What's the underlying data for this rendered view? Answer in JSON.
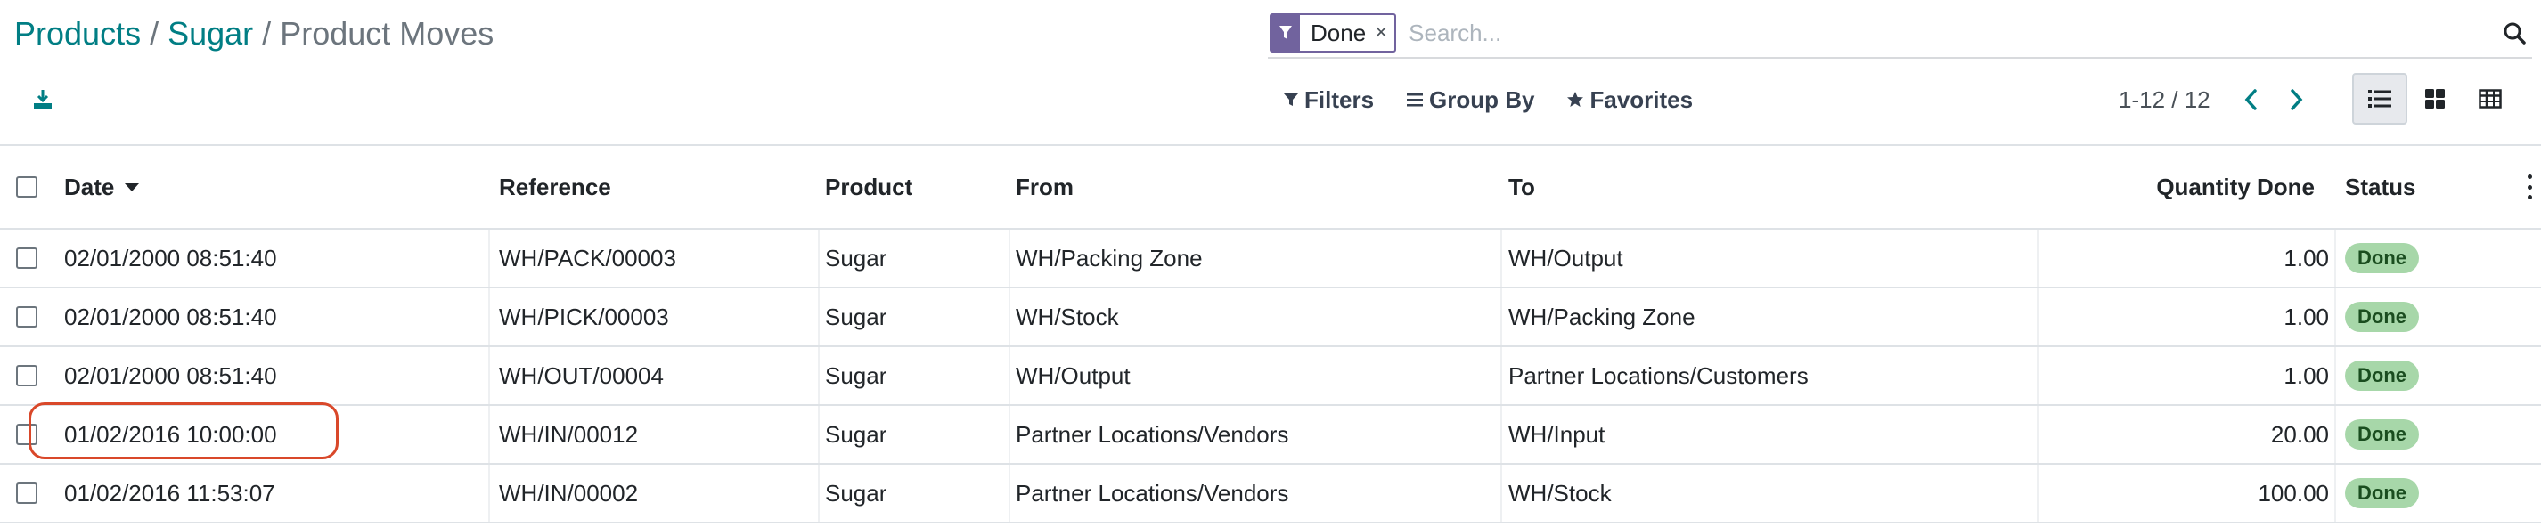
{
  "breadcrumb": {
    "items": [
      {
        "label": "Products"
      },
      {
        "label": "Sugar"
      }
    ],
    "separator": "/",
    "current": "Product Moves"
  },
  "toolbar": {
    "download_icon": "download-icon"
  },
  "search": {
    "facet_icon": "filter-icon",
    "facet_value": "Done",
    "facet_remove": "×",
    "placeholder": "Search...",
    "value": "",
    "search_icon": "search-icon"
  },
  "search_options": {
    "filters": "Filters",
    "group_by": "Group By",
    "favorites": "Favorites"
  },
  "pager": {
    "value": "1-12 / 12"
  },
  "views": [
    {
      "name": "list",
      "icon": "list-view-icon",
      "active": true
    },
    {
      "name": "kanban",
      "icon": "kanban-view-icon",
      "active": false
    },
    {
      "name": "pivot",
      "icon": "pivot-view-icon",
      "active": false
    }
  ],
  "table": {
    "columns": {
      "date": "Date",
      "reference": "Reference",
      "product": "Product",
      "from": "From",
      "to": "To",
      "qty": "Quantity Done",
      "status": "Status"
    },
    "sort_column": "date",
    "sort_direction": "descending",
    "rows": [
      {
        "date": "02/01/2000 08:51:40",
        "reference": "WH/PACK/00003",
        "product": "Sugar",
        "from": "WH/Packing Zone",
        "to": "WH/Output",
        "qty": "1.00",
        "status": "Done"
      },
      {
        "date": "02/01/2000 08:51:40",
        "reference": "WH/PICK/00003",
        "product": "Sugar",
        "from": "WH/Stock",
        "to": "WH/Packing Zone",
        "qty": "1.00",
        "status": "Done"
      },
      {
        "date": "02/01/2000 08:51:40",
        "reference": "WH/OUT/00004",
        "product": "Sugar",
        "from": "WH/Output",
        "to": "Partner Locations/Customers",
        "qty": "1.00",
        "status": "Done"
      },
      {
        "date": "01/02/2016 10:00:00",
        "reference": "WH/IN/00012",
        "product": "Sugar",
        "from": "Partner Locations/Vendors",
        "to": "WH/Input",
        "qty": "20.00",
        "status": "Done"
      },
      {
        "date": "01/02/2016 11:53:07",
        "reference": "WH/IN/00002",
        "product": "Sugar",
        "from": "Partner Locations/Vendors",
        "to": "WH/Stock",
        "qty": "100.00",
        "status": "Done"
      }
    ]
  },
  "annotation": {
    "highlighted_row": 3,
    "highlighted_column": "date",
    "color": "#d9482a"
  },
  "colors": {
    "breadcrumb_link": "#017e84",
    "facet": "#71639e",
    "status_badge_bg": "#a7d7a9",
    "status_badge_text": "#1a4d1f"
  }
}
